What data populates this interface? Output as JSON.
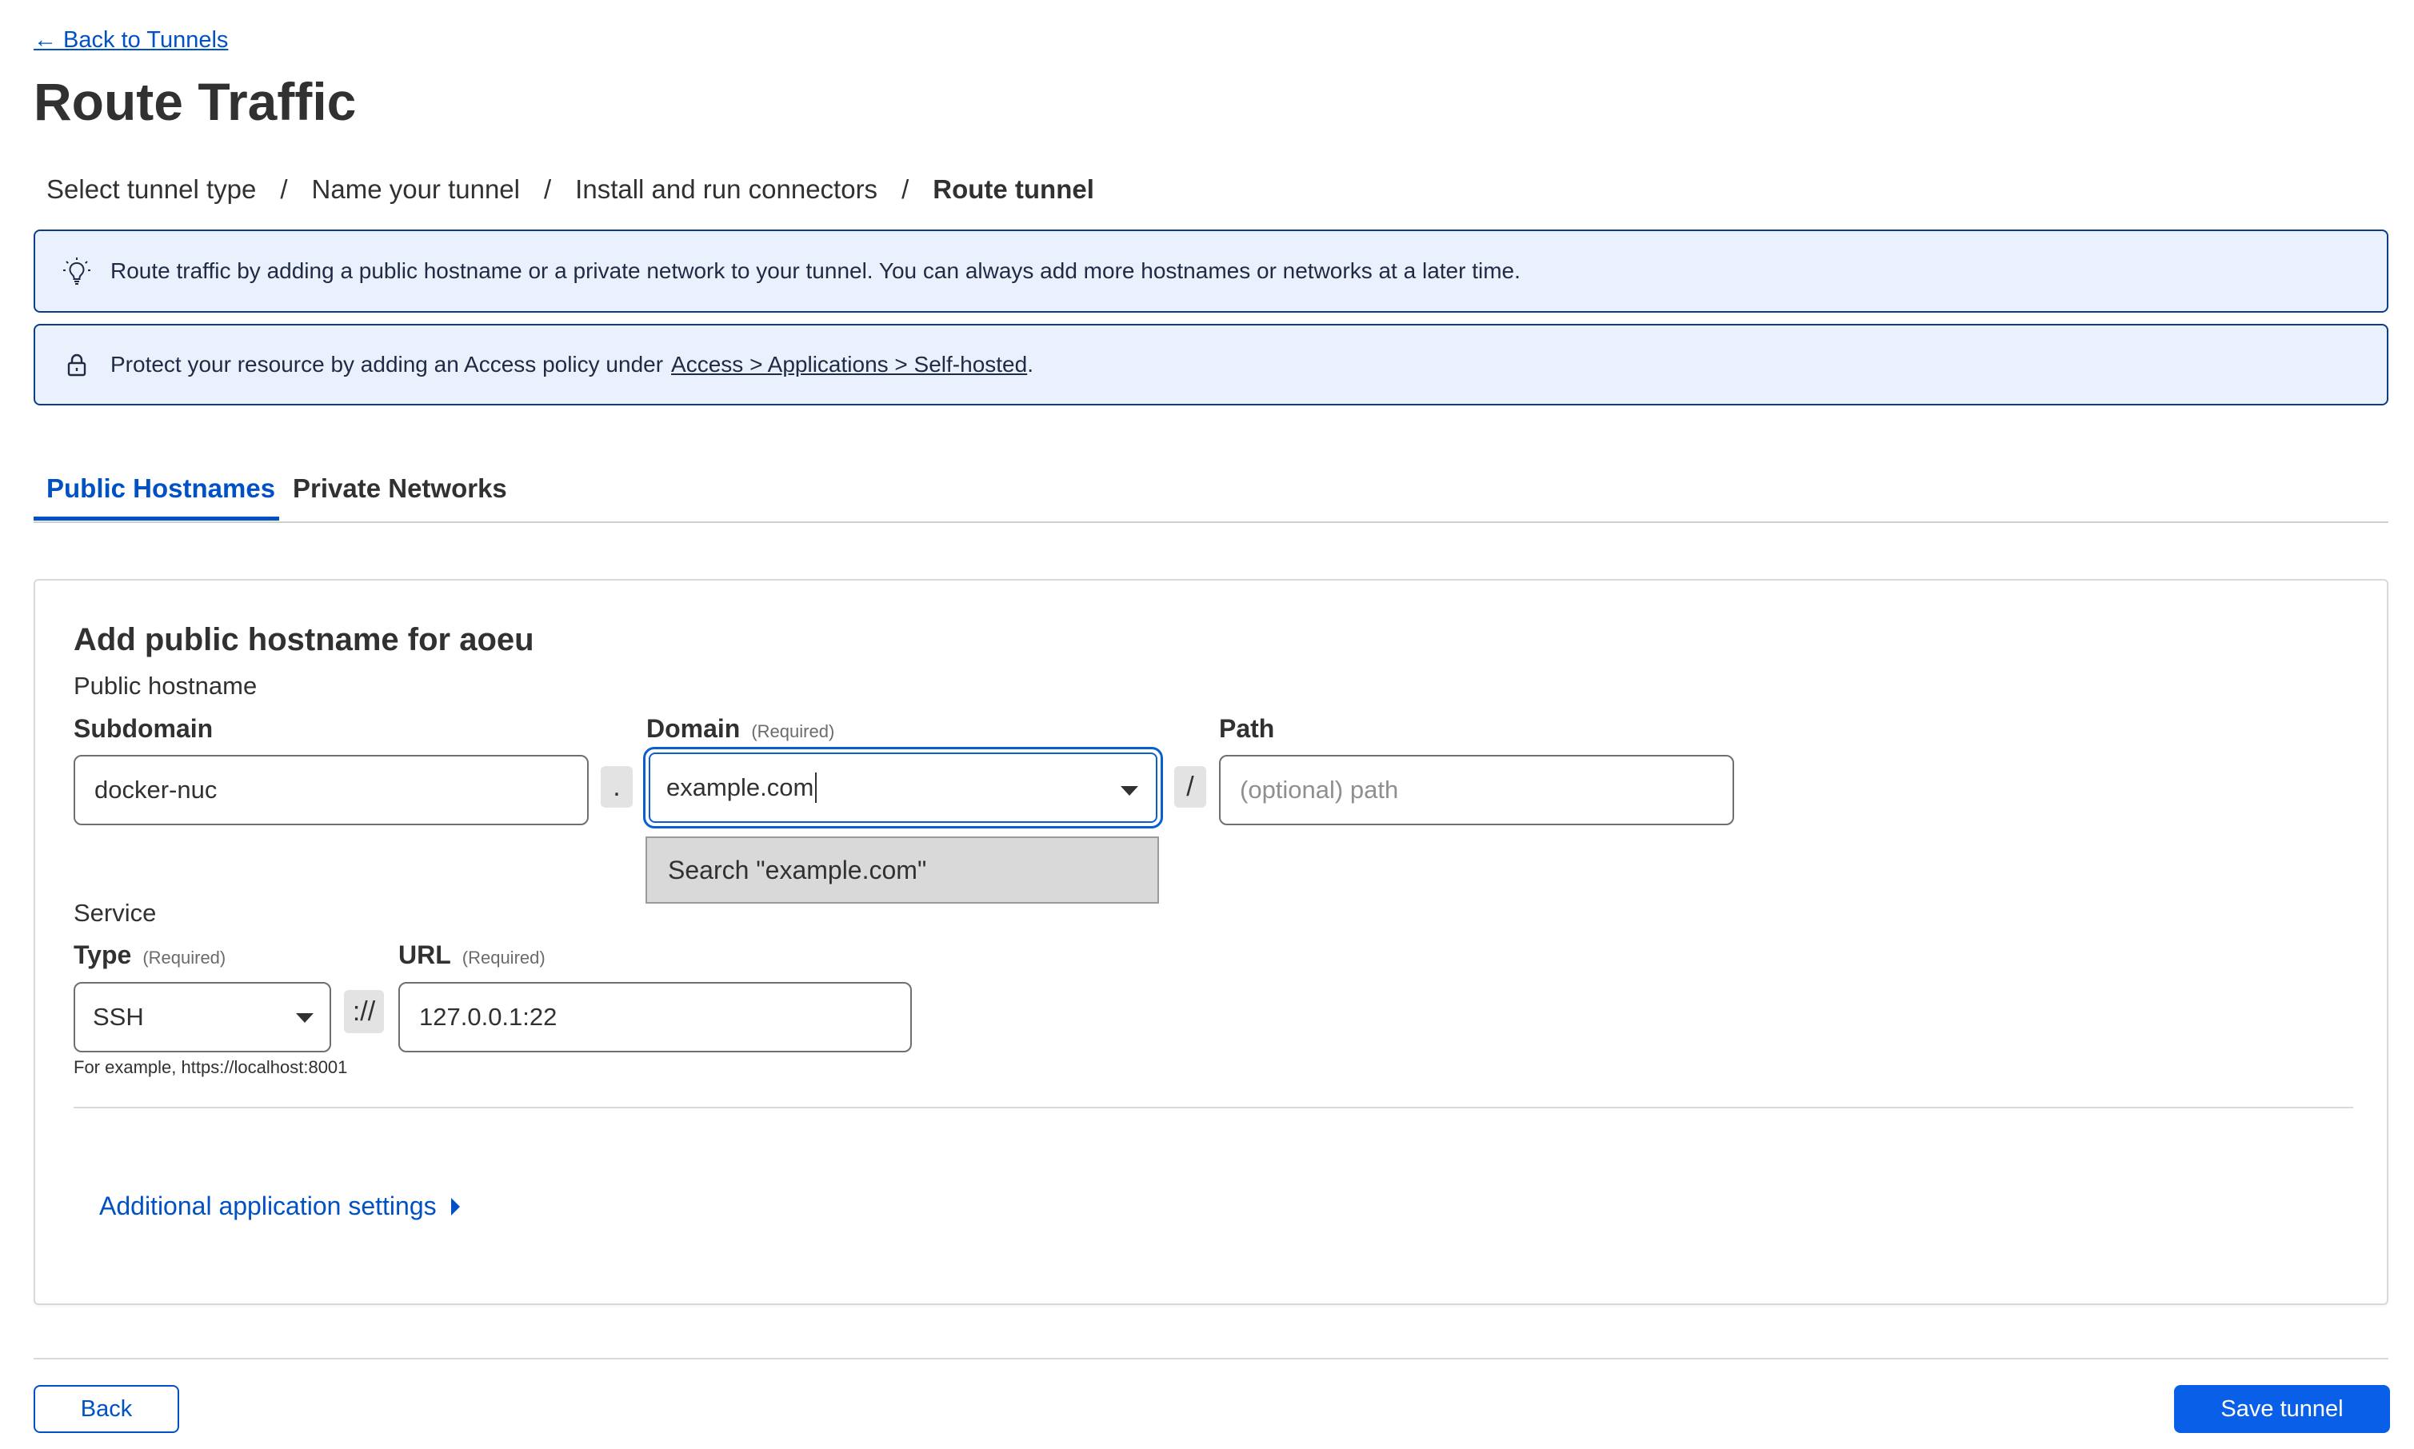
{
  "nav": {
    "back_link": "← Back to Tunnels"
  },
  "page": {
    "title": "Route Traffic"
  },
  "breadcrumb": {
    "steps": [
      "Select tunnel type",
      "Name your tunnel",
      "Install and run connectors",
      "Route tunnel"
    ],
    "separator": "/",
    "current_index": 3
  },
  "banners": {
    "info": {
      "icon": "lightbulb-icon",
      "text": "Route traffic by adding a public hostname or a private network to your tunnel. You can always add more hostnames or networks at a later time."
    },
    "access": {
      "icon": "lock-icon",
      "text": "Protect your resource by adding an Access policy under",
      "link": "Access > Applications > Self-hosted",
      "suffix": "."
    }
  },
  "tabs": [
    {
      "label": "Public Hostnames",
      "active": true
    },
    {
      "label": "Private Networks",
      "active": false
    }
  ],
  "form": {
    "title": "Add public hostname for aoeu",
    "public_hostname_label": "Public hostname",
    "subdomain": {
      "label": "Subdomain",
      "value": "docker-nuc"
    },
    "dot_separator": ".",
    "domain": {
      "label": "Domain",
      "required": "(Required)",
      "value": "example.com",
      "menu_option": "Search \"example.com\""
    },
    "slash_separator": "/",
    "path": {
      "label": "Path",
      "placeholder": "(optional) path",
      "value": ""
    },
    "service_label": "Service",
    "type": {
      "label": "Type",
      "required": "(Required)",
      "value": "SSH"
    },
    "scheme_separator": "://",
    "url": {
      "label": "URL",
      "required": "(Required)",
      "value": "127.0.0.1:22"
    },
    "example_hint": "For example, https://localhost:8001",
    "additional_settings": "Additional application settings"
  },
  "footer": {
    "back_label": "Back",
    "save_label": "Save tunnel"
  },
  "colors": {
    "accent": "#0051c3",
    "primary_button": "#0a5fe8",
    "banner_bg": "#eaf1fc",
    "banner_border": "#0a3d8a"
  }
}
